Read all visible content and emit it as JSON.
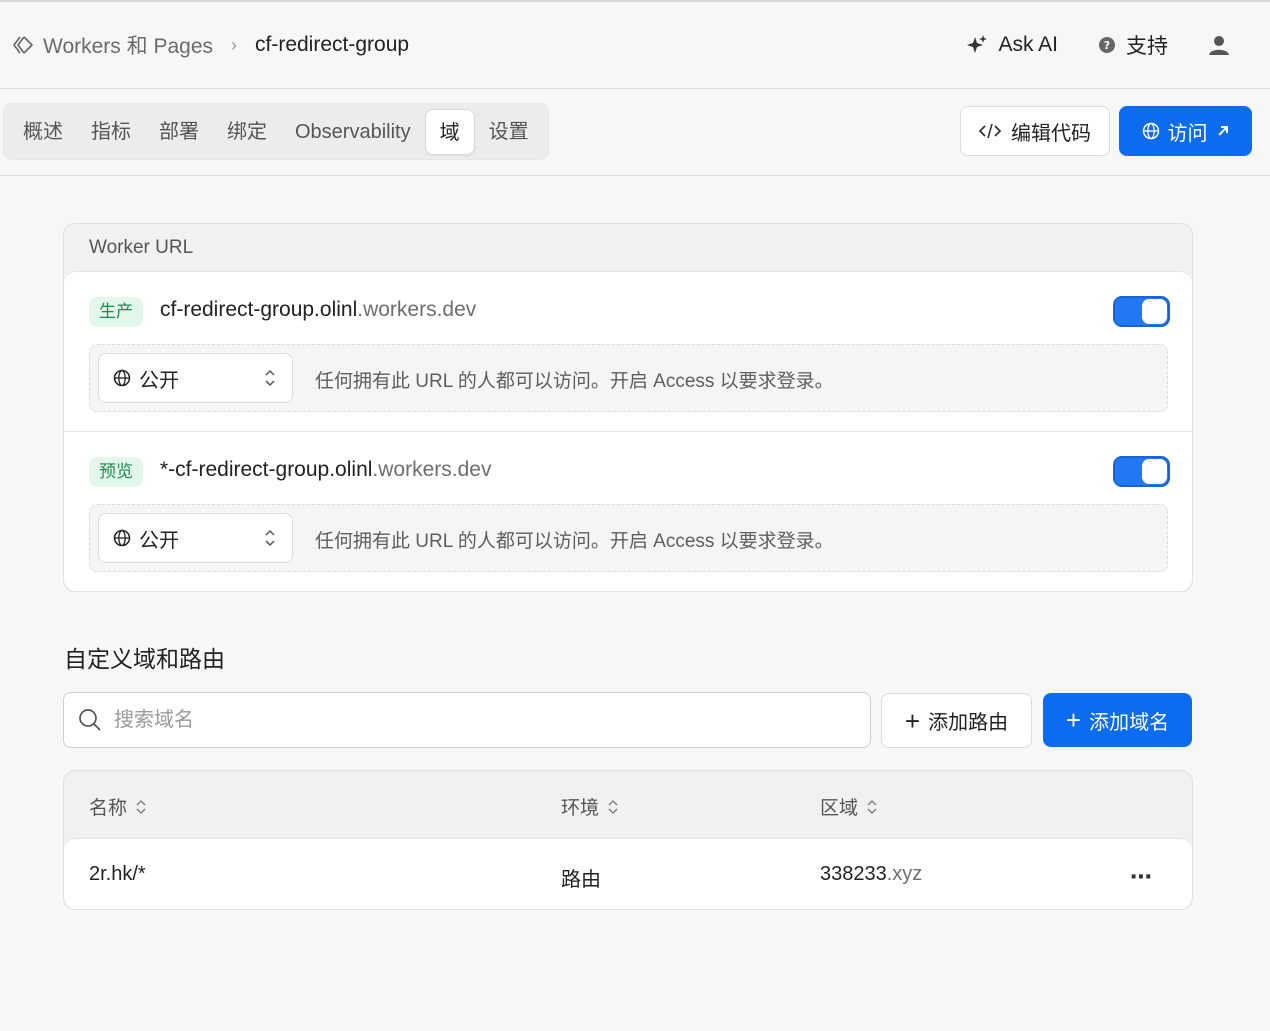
{
  "breadcrumb": {
    "root": "Workers 和 Pages",
    "current": "cf-redirect-group"
  },
  "header": {
    "ask_ai": "Ask AI",
    "support": "支持"
  },
  "tabs": [
    {
      "label": "概述"
    },
    {
      "label": "指标"
    },
    {
      "label": "部署"
    },
    {
      "label": "绑定"
    },
    {
      "label": "Observability"
    },
    {
      "label": "域",
      "active": true
    },
    {
      "label": "设置"
    }
  ],
  "actions": {
    "edit_code": "编辑代码",
    "visit": "访问"
  },
  "worker_url": {
    "title": "Worker URL",
    "entries": [
      {
        "badge": "生产",
        "url_main": "cf-redirect-group.olinl",
        "url_suffix": ".workers.dev",
        "enabled": true,
        "access_value": "公开",
        "access_desc": "任何拥有此 URL 的人都可以访问。开启 Access 以要求登录。"
      },
      {
        "badge": "预览",
        "url_main": "*-cf-redirect-group.olinl",
        "url_suffix": ".workers.dev",
        "enabled": true,
        "access_value": "公开",
        "access_desc": "任何拥有此 URL 的人都可以访问。开启 Access 以要求登录。"
      }
    ]
  },
  "custom_domains": {
    "title": "自定义域和路由",
    "search_placeholder": "搜索域名",
    "add_route": "添加路由",
    "add_domain": "添加域名",
    "columns": {
      "name": "名称",
      "env": "环境",
      "zone": "区域"
    },
    "rows": [
      {
        "name": "2r.hk/*",
        "env": "路由",
        "zone_main": "338233",
        "zone_suffix": ".xyz"
      }
    ]
  },
  "colors": {
    "accent": "#0b6cf2",
    "badge_bg": "#e2f7ea",
    "badge_text": "#1f8a4c"
  },
  "icons": [
    "workers-logo-icon",
    "chevron-right-icon",
    "sparkle-icon",
    "help-circle-icon",
    "user-icon",
    "code-icon",
    "globe-icon",
    "arrow-up-right-icon",
    "updown-chevron-icon",
    "search-icon",
    "plus-icon",
    "sort-icon",
    "more-icon"
  ]
}
